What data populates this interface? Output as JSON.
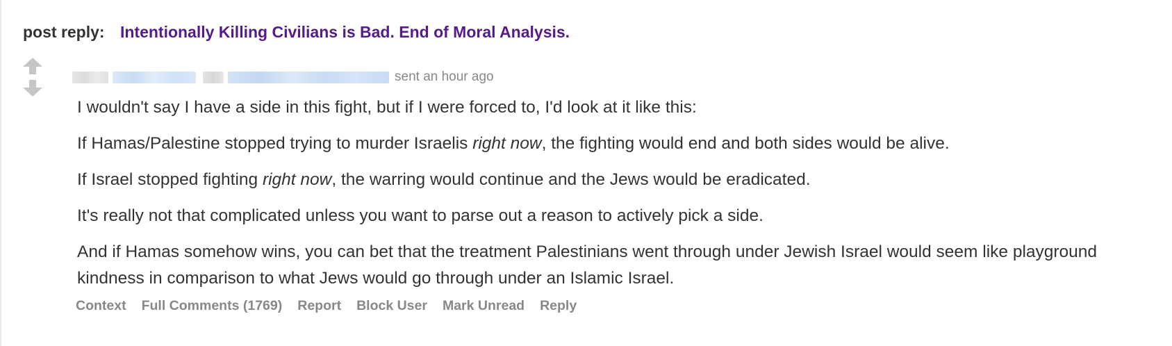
{
  "header": {
    "label": "post reply:",
    "post_title": "Intentionally Killing Civilians is Bad. End of Moral Analysis."
  },
  "meta": {
    "time": "sent an hour ago"
  },
  "comment": {
    "p1": "I wouldn't say I have a side in this fight, but if I were forced to, I'd look at it like this:",
    "p2_a": "If Hamas/Palestine stopped trying to murder Israelis ",
    "p2_em": "right now",
    "p2_b": ", the fighting would end and both sides would be alive.",
    "p3_a": "If Israel stopped fighting ",
    "p3_em": "right now",
    "p3_b": ", the warring would continue and the Jews would be eradicated.",
    "p4": "It's really not that complicated unless you want to parse out a reason to actively pick a side.",
    "p5": "And if Hamas somehow wins, you can bet that the treatment Palestinians went through under Jewish Israel would seem like playground kindness in comparison to what Jews would go through under an Islamic Israel."
  },
  "actions": {
    "context": "Context",
    "full_comments": "Full Comments (1769)",
    "report": "Report",
    "block_user": "Block User",
    "mark_unread": "Mark Unread",
    "reply": "Reply"
  },
  "icons": {
    "upvote": "arrow-up-icon",
    "downvote": "arrow-down-icon"
  },
  "colors": {
    "title_link": "#551a8b",
    "meta_text": "#888888",
    "vote_arrow": "#c6c6c6"
  }
}
